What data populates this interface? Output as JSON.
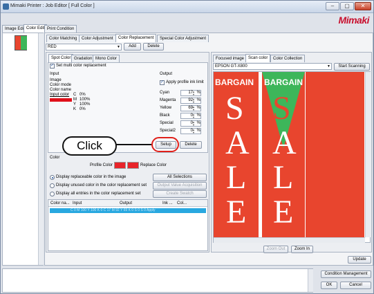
{
  "window": {
    "title": "Mimaki Printer : Job Editor [ Full Color ]",
    "brand": "Mimaki",
    "btn_min": "–",
    "btn_max": "▢",
    "btn_close": "✕"
  },
  "main_tabs": [
    "Image Edit",
    "Color Edit",
    "Print Condition"
  ],
  "sub_tabs": [
    "Color Matching",
    "Color Adjustment",
    "Color Replacement",
    "Special Color Adjustment"
  ],
  "color_select": {
    "value": "RED"
  },
  "top_buttons": {
    "add": "Add",
    "delete": "Delete"
  },
  "inner_tabs": [
    "Spot Color",
    "Gradation",
    "Mono Color"
  ],
  "multi_replace": {
    "label": "Set multi color replacement",
    "checked": true
  },
  "input": {
    "header": "Input",
    "lines": [
      "Image",
      "Color mode",
      "Color name"
    ],
    "color_label": "Input color",
    "cmyk": [
      {
        "k": "C",
        "v": "0%"
      },
      {
        "k": "M",
        "v": "100%"
      },
      {
        "k": "Y",
        "v": "100%"
      },
      {
        "k": "K",
        "v": "0%"
      }
    ],
    "swatch": "#e0101a"
  },
  "output": {
    "header": "Output",
    "apply_label": "Apply profile ink limit",
    "apply_checked": true,
    "rows": [
      {
        "name": "Cyan",
        "value": "17"
      },
      {
        "name": "Magenta",
        "value": "92"
      },
      {
        "name": "Yellow",
        "value": "69"
      },
      {
        "name": "Black",
        "value": "0"
      },
      {
        "name": "Special",
        "value": "0"
      },
      {
        "name": "Special2",
        "value": "0"
      }
    ],
    "unit": "%"
  },
  "action_buttons": {
    "setup": "Setup",
    "delete": "Delete"
  },
  "callout": {
    "label": "Click"
  },
  "color_section": {
    "header": "Color",
    "profile_label": "Profile Color",
    "replace_label": "Replace Color",
    "profile_swatch": "#e8242a",
    "replace_swatch": "#e8242a"
  },
  "display_options": [
    {
      "label": "Display replaceable color in the image",
      "selected": true,
      "button": "All Selections",
      "button_enabled": true
    },
    {
      "label": "Display unused color in the color replacement set",
      "selected": false,
      "button": "Output Value Acquisition",
      "button_enabled": false
    },
    {
      "label": "Display all entries in the color replacement set",
      "selected": false,
      "button": "Create Swatch",
      "button_enabled": false
    }
  ],
  "table": {
    "headers": [
      "Color na...",
      "Input",
      "Output",
      "Ink ...",
      "Col..."
    ],
    "row": "C 0 M 100 Y 100 K 0    C 17 M 92 Y 69 K 0 S 0 S 0    Apply",
    "row_color": "#29a8e0"
  },
  "right_tabs": [
    "Focused image",
    "Scan color",
    "Color Collection"
  ],
  "scanner": {
    "value": "EPSON GT-X800",
    "start": "Start Scanning"
  },
  "poster": {
    "bargain": "BARGAIN",
    "letters": [
      "S",
      "A",
      "L",
      "E"
    ],
    "red": "#e8452e",
    "green": "#3db65a"
  },
  "zoom": {
    "out": "Zoom Out",
    "in": "Zoom In"
  },
  "update": "Update",
  "bottom": {
    "condition": "Condition Management",
    "ok": "OK",
    "cancel": "Cancel"
  }
}
